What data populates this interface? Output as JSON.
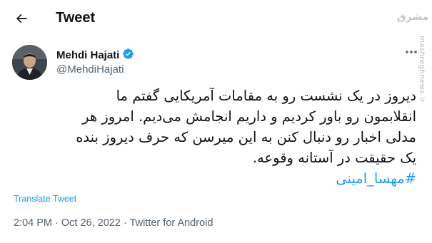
{
  "header": {
    "title": "Tweet"
  },
  "watermark": {
    "logo_text": "مشرق",
    "site_text": "mashreghnews.ir"
  },
  "author": {
    "name": "Mehdi Hajati",
    "handle": "@MehdiHajati",
    "verified": true
  },
  "tweet": {
    "lines": [
      "دیروز در یک نشست رو به مقامات آمریکایی گفتم ما",
      "انقلابمون رو باور کردیم و داریم انجامش می‌دیم. امروز هر",
      "مدلی اخبار رو دنبال کنن به این میرسن که حرف دیروز بنده",
      "یک حقیقت در آستانه وقوعه."
    ],
    "hashtag": "#مهسا_امینی"
  },
  "translate_label": "Translate Tweet",
  "meta": {
    "time": "2:04 PM",
    "date": "Oct 26, 2022",
    "source": "Twitter for Android"
  },
  "colors": {
    "accent": "#1d9bf0",
    "text": "#0f1419",
    "muted": "#536471"
  }
}
